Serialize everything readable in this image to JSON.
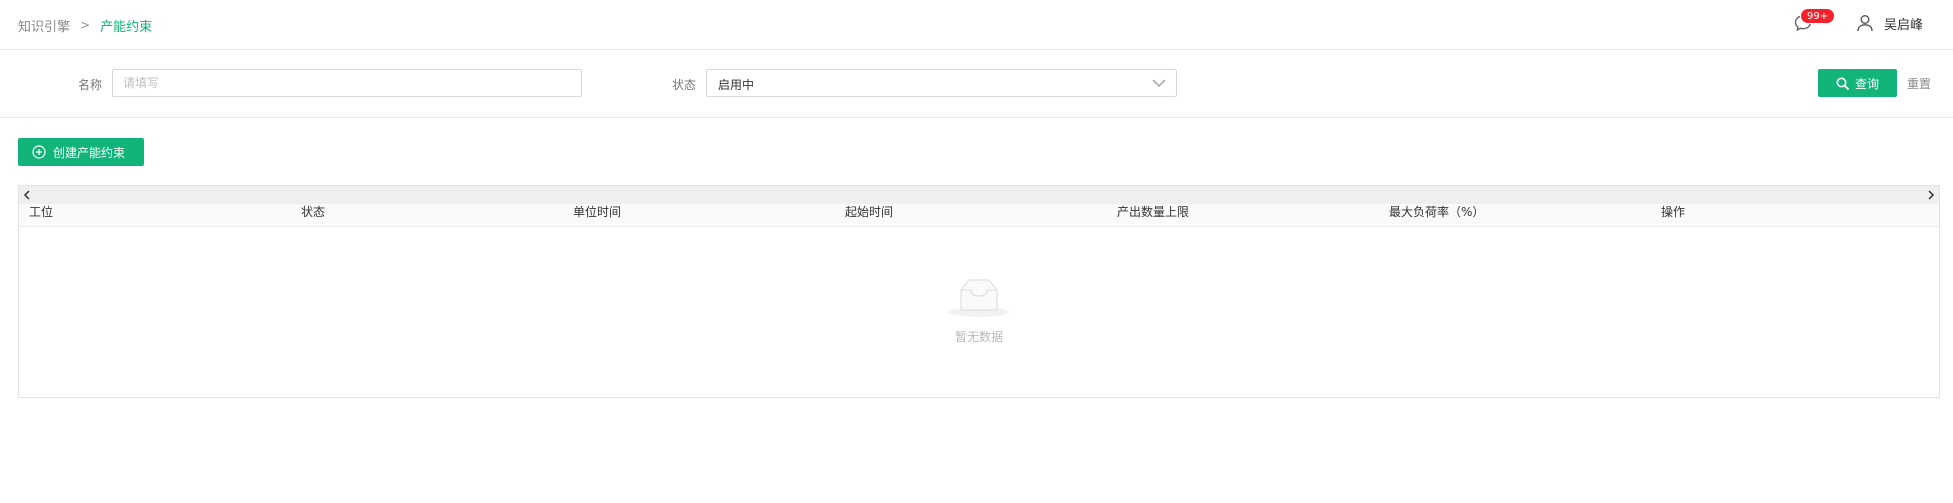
{
  "breadcrumb": {
    "parent": "知识引擎",
    "separator": ">",
    "current": "产能约束"
  },
  "header": {
    "message_badge": "99+",
    "user_name": "吴启峰"
  },
  "filters": {
    "name_label": "名称",
    "name_placeholder": "请填写",
    "name_value": "",
    "status_label": "状态",
    "status_value": "启用中",
    "query_label": "查询",
    "reset_label": "重置"
  },
  "toolbar": {
    "create_label": "创建产能约束"
  },
  "table": {
    "columns": [
      "工位",
      "状态",
      "单位时间",
      "起始时间",
      "产出数量上限",
      "最大负荷率（%）",
      "操作"
    ],
    "rows": [],
    "empty_text": "暂无数据"
  },
  "colors": {
    "brand": "#12b47a",
    "badge": "#f5222d"
  },
  "icons": {
    "message": "message-icon",
    "user": "user-icon",
    "search": "search-icon",
    "create": "plus-circle-icon",
    "dropdown": "chevron-down-icon",
    "empty": "empty-inbox-icon"
  }
}
